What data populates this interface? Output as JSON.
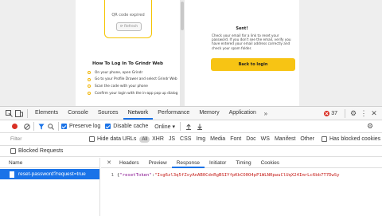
{
  "page": {
    "qr": {
      "expired_text": "QR code expired",
      "refresh_label": "Refresh"
    },
    "howto": {
      "title": "How To Log In To Grindr Web",
      "steps": [
        "On your phone, open Grindr",
        "Go to your Profile Drawer and select Grindr Web",
        "Scan the code with your phone",
        "Confirm your login with the in-app pop up dialog"
      ]
    },
    "sent": {
      "title": "Sent!",
      "description": "Check your email for a link to reset your password. If you don't see the email, verify you have entered your email address correctly and check your spam folder.",
      "back_button": "Back to login"
    }
  },
  "devtools": {
    "tabs": [
      "Elements",
      "Console",
      "Sources",
      "Network",
      "Performance",
      "Memory",
      "Application"
    ],
    "active_tab": "Network",
    "more_tabs_icon": "double-chevron-icon",
    "error_count": "37",
    "toolbar": {
      "preserve_log": "Preserve log",
      "disable_cache": "Disable cache",
      "throttle": "Online"
    },
    "filter": {
      "placeholder": "Filter",
      "hide_data_urls": "Hide data URLs",
      "types": [
        "All",
        "XHR",
        "JS",
        "CSS",
        "Img",
        "Media",
        "Font",
        "Doc",
        "WS",
        "Manifest",
        "Other"
      ],
      "has_blocked_cookies": "Has blocked cookies",
      "blocked_requests": "Blocked Requests"
    },
    "name_header": "Name",
    "request": "reset-password?request=true",
    "detail_tabs": [
      "Headers",
      "Preview",
      "Response",
      "Initiator",
      "Timing",
      "Cookies"
    ],
    "active_detail_tab": "Response",
    "response": {
      "line_number": "1",
      "open": "{",
      "key": "\"resetToken\"",
      "colon": ":",
      "value": "\"Isg6zl3q5fZsyAnAB0CdnRgBSIYfpKkCO0O4pP1WLN0pwuClUqX24ImrLc6bb7T7DwSy"
    },
    "colors": {
      "accent": "#1a73e8",
      "error": "#d93025",
      "record": "#d93025"
    }
  }
}
